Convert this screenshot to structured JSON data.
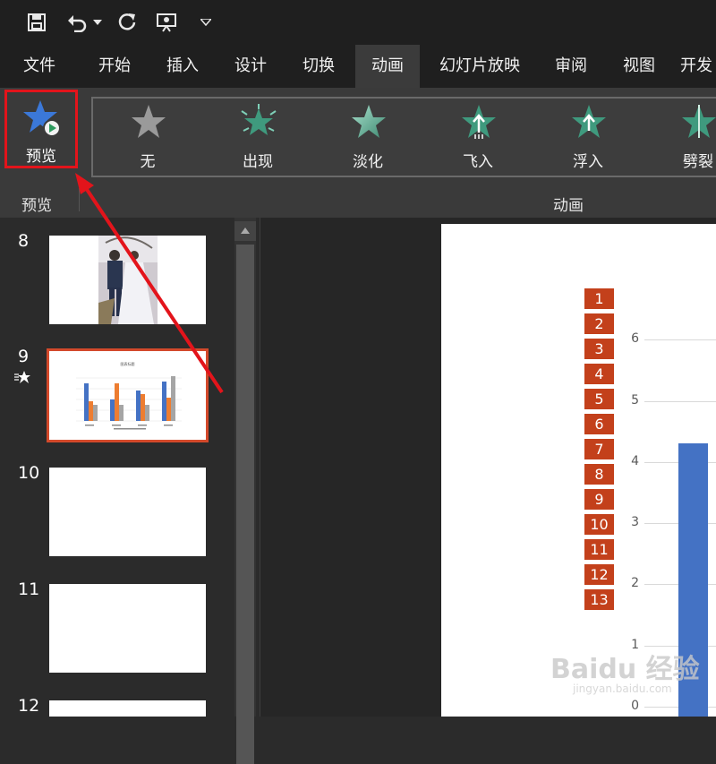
{
  "qat": {
    "icons": [
      "save-icon",
      "undo-icon",
      "undo-dropdown-icon",
      "redo-icon",
      "present-from-start-icon",
      "customize-qat-icon"
    ]
  },
  "tabs": [
    "文件",
    "开始",
    "插入",
    "设计",
    "切换",
    "动画",
    "幻灯片放映",
    "审阅",
    "视图",
    "开发"
  ],
  "active_tab": "动画",
  "ribbon": {
    "preview_label": "预览",
    "animations": [
      {
        "label": "无",
        "icon": "star-gray-icon"
      },
      {
        "label": "出现",
        "icon": "star-burst-icon"
      },
      {
        "label": "淡化",
        "icon": "star-fade-icon"
      },
      {
        "label": "飞入",
        "icon": "star-fly-in-icon"
      },
      {
        "label": "浮入",
        "icon": "star-float-in-icon"
      },
      {
        "label": "劈裂",
        "icon": "star-split-icon"
      }
    ],
    "group_preview": "预览",
    "group_animation": "动画"
  },
  "slides": [
    {
      "number": "8"
    },
    {
      "number": "9",
      "has_animation": true
    },
    {
      "number": "10"
    },
    {
      "number": "11"
    },
    {
      "number": "12"
    }
  ],
  "slide9_thumb_title": "图表标题",
  "annotation": {
    "highlight_color": "#e3141b"
  },
  "canvas": {
    "sequence_badges": [
      "1",
      "2",
      "3",
      "4",
      "5",
      "6",
      "7",
      "8",
      "9",
      "10",
      "11",
      "12",
      "13"
    ],
    "y_ticks": [
      "6",
      "5",
      "4",
      "3",
      "2",
      "1",
      "0"
    ]
  },
  "chart_data": {
    "type": "bar",
    "title": "",
    "ylim": [
      0,
      6
    ],
    "series": [
      {
        "values": [
          4.3
        ]
      }
    ]
  },
  "watermark": {
    "brand": "Baidu 经验",
    "url": "jingyan.baidu.com"
  },
  "colors": {
    "accent": "#c3401b",
    "bar": "#4472c4",
    "selected_border": "#d3492b"
  }
}
